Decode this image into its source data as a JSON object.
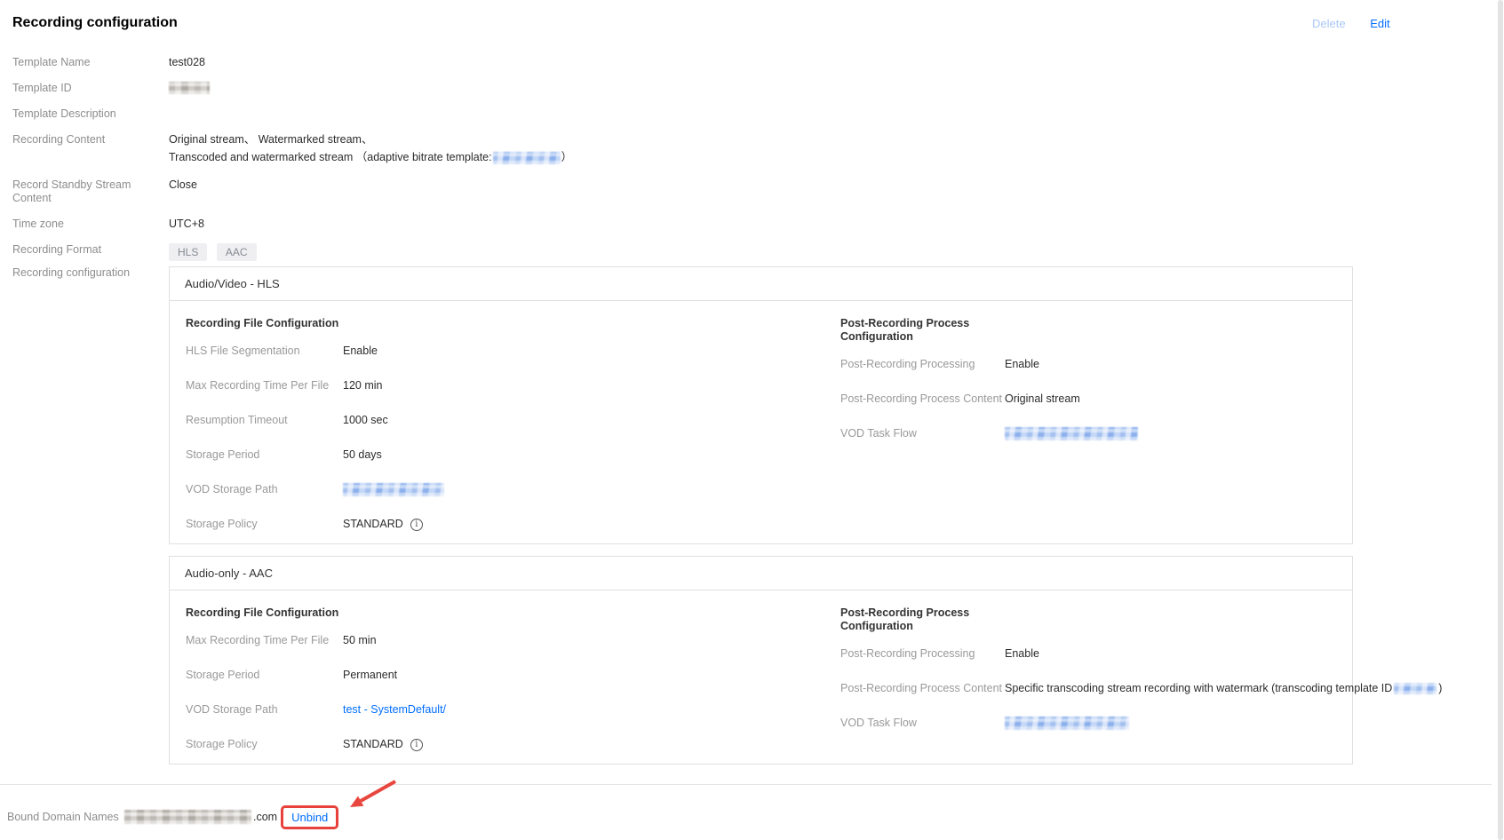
{
  "page": {
    "title": "Recording configuration",
    "actions": {
      "delete": "Delete",
      "edit": "Edit"
    }
  },
  "fields": {
    "template_name": {
      "label": "Template Name",
      "value": "test028"
    },
    "template_id": {
      "label": "Template ID"
    },
    "template_description": {
      "label": "Template Description",
      "value": ""
    },
    "recording_content": {
      "label": "Recording Content",
      "line1": "Original stream、 Watermarked stream、",
      "line2_prefix": "Transcoded and watermarked stream （adaptive bitrate template:",
      "line2_suffix": "）"
    },
    "record_standby": {
      "label": "Record Standby Stream Content",
      "value": "Close"
    },
    "time_zone": {
      "label": "Time zone",
      "value": "UTC+8"
    },
    "recording_format": {
      "label": "Recording Format",
      "tags": [
        "HLS",
        "AAC"
      ]
    },
    "recording_configuration": {
      "label": "Recording configuration"
    }
  },
  "panels": {
    "hls": {
      "header": "Audio/Video - HLS",
      "file_config": {
        "title": "Recording File Configuration",
        "rows": {
          "segmentation": {
            "label": "HLS File Segmentation",
            "value": "Enable"
          },
          "max_time": {
            "label": "Max Recording Time Per File",
            "value": "120 min"
          },
          "resumption": {
            "label": "Resumption Timeout",
            "value": "1000 sec"
          },
          "storage_period": {
            "label": "Storage Period",
            "value": "50 days"
          },
          "vod_storage_path": {
            "label": "VOD Storage Path"
          },
          "storage_policy": {
            "label": "Storage Policy",
            "value": "STANDARD"
          }
        }
      },
      "post_process": {
        "title": "Post-Recording Process Configuration",
        "rows": {
          "processing": {
            "label": "Post-Recording Processing",
            "value": "Enable"
          },
          "content": {
            "label": "Post-Recording Process Content",
            "value": "Original stream"
          },
          "vod_task_flow": {
            "label": "VOD Task Flow"
          }
        }
      }
    },
    "aac": {
      "header": "Audio-only - AAC",
      "file_config": {
        "title": "Recording File Configuration",
        "rows": {
          "max_time": {
            "label": "Max Recording Time Per File",
            "value": "50 min"
          },
          "storage_period": {
            "label": "Storage Period",
            "value": "Permanent"
          },
          "vod_storage_path": {
            "label": "VOD Storage Path",
            "value": "test - SystemDefault/"
          },
          "storage_policy": {
            "label": "Storage Policy",
            "value": "STANDARD"
          }
        }
      },
      "post_process": {
        "title": "Post-Recording Process Configuration",
        "rows": {
          "processing": {
            "label": "Post-Recording Processing",
            "value": "Enable"
          },
          "content": {
            "label": "Post-Recording Process Content",
            "value_prefix": "Specific transcoding stream recording with watermark (transcoding template ID",
            "value_suffix": ")"
          },
          "vod_task_flow": {
            "label": "VOD Task Flow"
          }
        }
      }
    }
  },
  "bound_domains": {
    "label": "Bound Domain Names",
    "domain_suffix": ".com",
    "unbind_label": "Unbind"
  },
  "icons": {
    "info": "i"
  },
  "colors": {
    "accent_blue": "#006eff",
    "disabled_blue": "#a9c7f7",
    "annotation_red": "#e8403a"
  }
}
